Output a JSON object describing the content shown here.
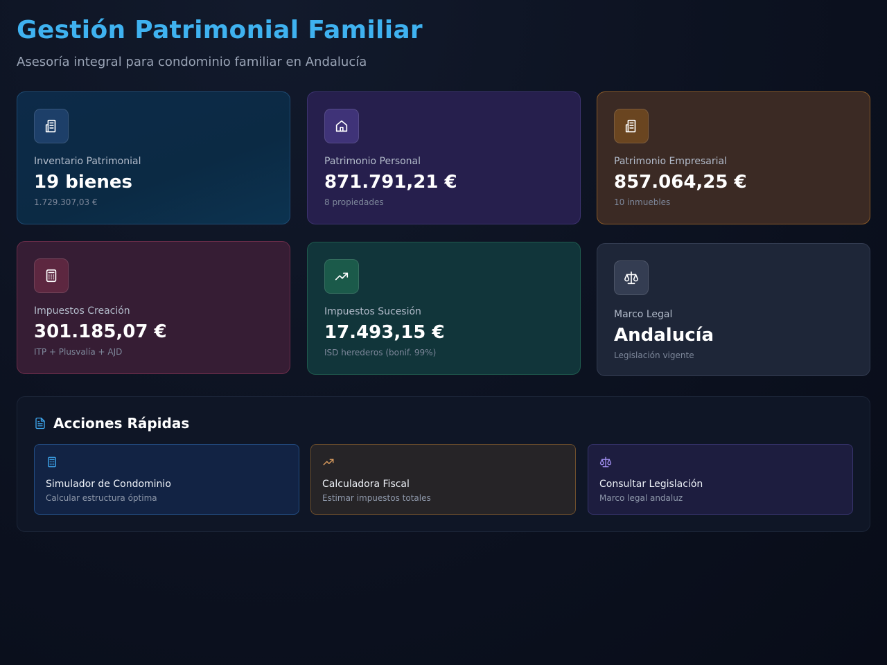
{
  "header": {
    "title": "Gestión Patrimonial Familiar",
    "subtitle": "Asesoría integral para condominio familiar en Andalucía"
  },
  "cards": [
    {
      "icon": "building-icon",
      "label": "Inventario Patrimonial",
      "value": "19 bienes",
      "sub": "1.729.307,03 €",
      "accent": "#1d3f69"
    },
    {
      "icon": "home-icon",
      "label": "Patrimonio Personal",
      "value": "871.791,21 €",
      "sub": "8 propiedades",
      "accent": "#3f3378"
    },
    {
      "icon": "building-icon",
      "label": "Patrimonio Empresarial",
      "value": "857.064,25 €",
      "sub": "10 inmuebles",
      "accent": "#6a4520"
    },
    {
      "icon": "calculator-icon",
      "label": "Impuestos Creación",
      "value": "301.185,07 €",
      "sub": "ITP + Plusvalía + AJD",
      "accent": "#5d2740"
    },
    {
      "icon": "trending-up-icon",
      "label": "Impuestos Sucesión",
      "value": "17.493,15 €",
      "sub": "ISD herederos (bonif. 99%)",
      "accent": "#1b5a4a"
    },
    {
      "icon": "scale-icon",
      "label": "Marco Legal",
      "value": "Andalucía",
      "sub": "Legislación vigente",
      "accent": "#343d52"
    }
  ],
  "quick_actions": {
    "title": "Acciones Rápidas",
    "icon": "document-icon",
    "items": [
      {
        "icon": "calculator-icon",
        "title": "Simulador de Condominio",
        "sub": "Calcular estructura óptima",
        "color": "#3fa8f0"
      },
      {
        "icon": "trending-up-icon",
        "title": "Calculadora Fiscal",
        "sub": "Estimar impuestos totales",
        "color": "#e0a060"
      },
      {
        "icon": "scale-icon",
        "title": "Consultar Legislación",
        "sub": "Marco legal andaluz",
        "color": "#a08ef0"
      }
    ]
  },
  "colors": {
    "title": "#3fb2f0",
    "background": "#0d1322"
  }
}
